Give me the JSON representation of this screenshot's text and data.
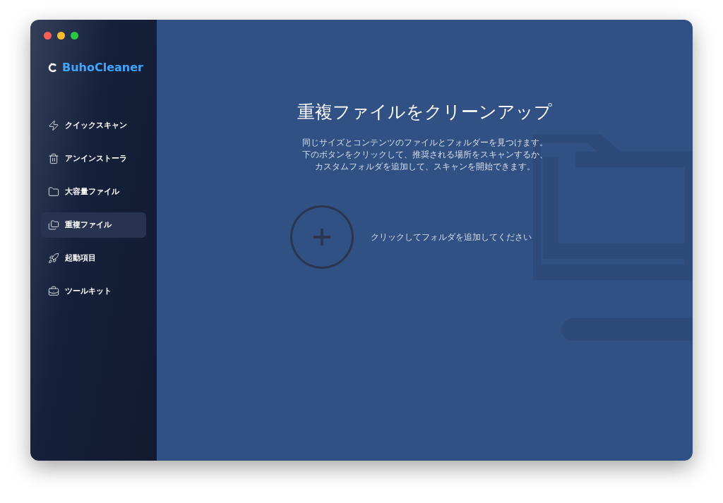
{
  "app": {
    "name": "BuhoCleaner"
  },
  "sidebar": {
    "items": [
      {
        "label": "クイックスキャン",
        "selected": false
      },
      {
        "label": "アンインストーラ",
        "selected": false
      },
      {
        "label": "大容量ファイル",
        "selected": false
      },
      {
        "label": "重複ファイル",
        "selected": true
      },
      {
        "label": "起動項目",
        "selected": false
      },
      {
        "label": "ツールキット",
        "selected": false
      }
    ]
  },
  "main": {
    "title": "重複ファイルをクリーンアップ",
    "description": [
      "同じサイズとコンテンツのファイルとフォルダーを見つけます。",
      "下のボタンをクリックして、推奨される場所をスキャンするか、",
      "カスタムフォルダを追加して、スキャンを開始できます。"
    ],
    "add_folder_hint": "クリックしてフォルダを追加してください"
  }
}
